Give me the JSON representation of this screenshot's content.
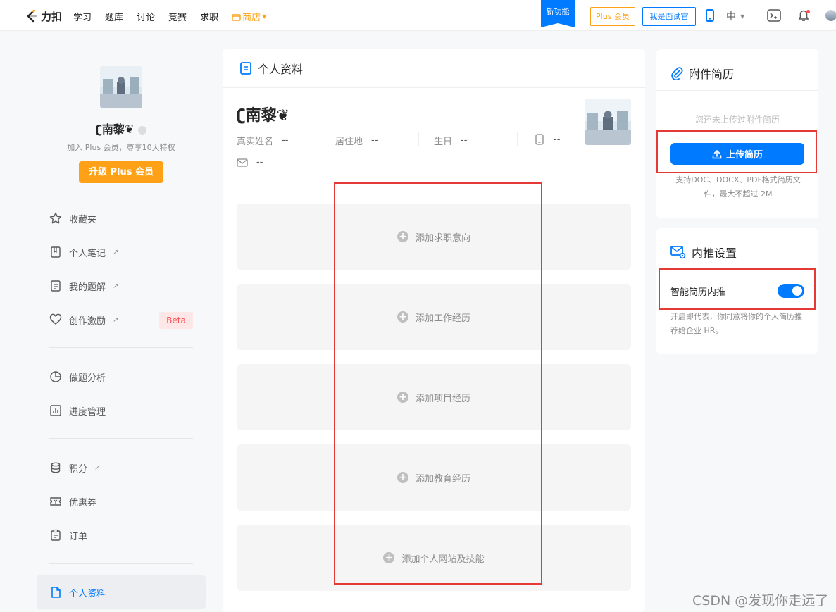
{
  "topnav": {
    "logo_text": "力扣",
    "items": [
      "学习",
      "题库",
      "讨论",
      "竞赛",
      "求职"
    ],
    "store_label": "商店",
    "new_feature_badge": "新功能",
    "plus_button": "Plus 会员",
    "interviewer_button": "我是面试官",
    "language": "中"
  },
  "sidebar": {
    "username": "ʗ南黎❦",
    "join_plus_text": "加入 Plus 会员，尊享10大特权",
    "upgrade_button": "升级 Plus 会员",
    "menu": [
      {
        "label": "收藏夹"
      },
      {
        "label": "个人笔记"
      },
      {
        "label": "我的题解"
      },
      {
        "label": "创作激励"
      },
      {
        "label": "做题分析"
      },
      {
        "label": "进度管理"
      },
      {
        "label": "积分"
      },
      {
        "label": "优惠券"
      },
      {
        "label": "订单"
      },
      {
        "label": "个人资料"
      }
    ],
    "beta_badge": "Beta"
  },
  "profile": {
    "header_title": "个人资料",
    "name": "ʗ南黎❦",
    "fields": {
      "real_name_label": "真实姓名",
      "real_name_value": "--",
      "location_label": "居住地",
      "location_value": "--",
      "birthday_label": "生日",
      "birthday_value": "--",
      "phone_value": "--",
      "email_value": "--"
    },
    "add_sections": [
      "添加求职意向",
      "添加工作经历",
      "添加项目经历",
      "添加教育经历",
      "添加个人网站及技能"
    ]
  },
  "resume_card": {
    "title": "附件简历",
    "no_resume_text": "您还未上传过附件简历",
    "upload_button": "上传简历",
    "support_text": "支持DOC、DOCX、PDF格式简历文件，最大不超过 2M"
  },
  "referral_card": {
    "title": "内推设置",
    "toggle_label": "智能简历内推",
    "toggle_on": true,
    "description": "开启即代表，你同意将你的个人简历推荐给企业 HR。"
  },
  "colors": {
    "accent": "#007aff",
    "plus_orange": "#ffa116",
    "highlight_red": "#e53935"
  },
  "watermark": "CSDN @发现你走远了"
}
